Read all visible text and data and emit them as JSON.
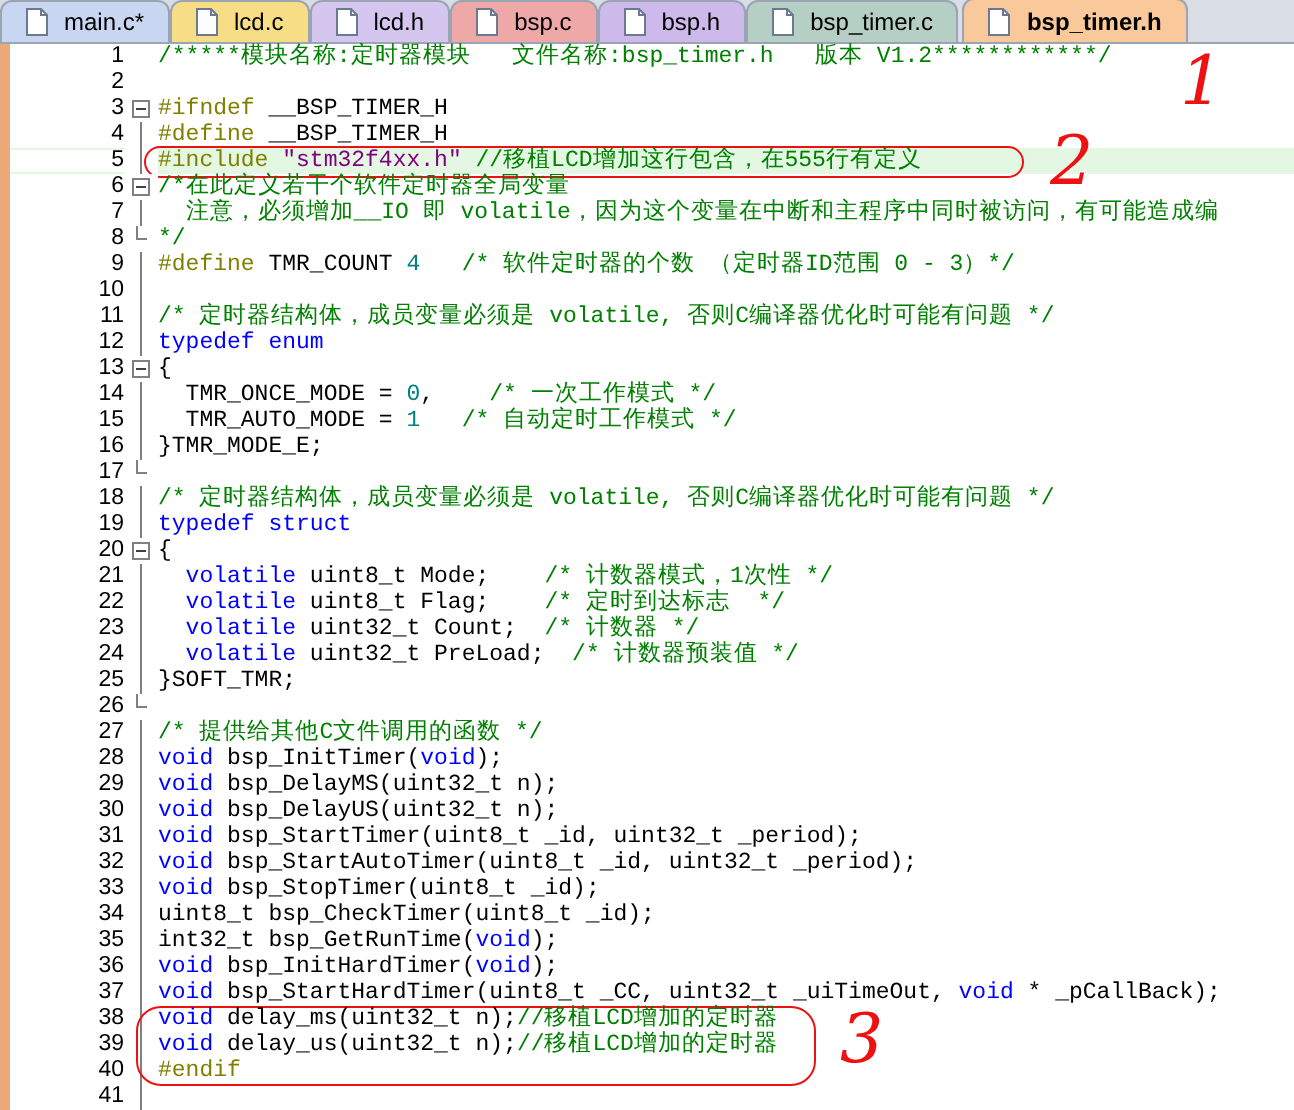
{
  "tabs": [
    {
      "label": "main.c*",
      "selected": false,
      "color": "#c8d6f2"
    },
    {
      "label": "lcd.c",
      "selected": false,
      "color": "#f7dd86"
    },
    {
      "label": "lcd.h",
      "selected": false,
      "color": "#d4c6ee"
    },
    {
      "label": "bsp.c",
      "selected": false,
      "color": "#eea8a8"
    },
    {
      "label": "bsp.h",
      "selected": false,
      "color": "#cdb9ea"
    },
    {
      "label": "bsp_timer.c",
      "selected": false,
      "color": "#b5cfc4"
    },
    {
      "label": "bsp_timer.h",
      "selected": true,
      "color": "#f9c99b"
    }
  ],
  "editor": {
    "lines": [
      {
        "number": "1",
        "kind": "line",
        "highlighted": false,
        "segments": [
          {
            "kind": "comment",
            "text": "/*****模块名称:定时器模块   文件名称:bsp_timer.h   版本 V1.2************/"
          }
        ]
      },
      {
        "number": "2",
        "kind": "line",
        "highlighted": false
      },
      {
        "number": "3",
        "kind": "foldstart",
        "highlighted": false,
        "segments": [
          {
            "kind": "preproc",
            "text": "#ifndef"
          },
          {
            "kind": "plain",
            "text": " __BSP_TIMER_H"
          }
        ]
      },
      {
        "number": "4",
        "kind": "line",
        "highlighted": false,
        "segments": [
          {
            "kind": "preproc",
            "text": "#define"
          },
          {
            "kind": "plain",
            "text": " __BSP_TIMER_H"
          }
        ]
      },
      {
        "number": "5",
        "kind": "line",
        "highlighted": true,
        "segments": [
          {
            "kind": "preproc",
            "text": "#include "
          },
          {
            "kind": "string",
            "text": "\"stm32f4xx.h\""
          },
          {
            "kind": "comment",
            "text": " //移植LCD增加这行包含，在555行有定义"
          }
        ]
      },
      {
        "number": "6",
        "kind": "foldstart",
        "highlighted": false,
        "segments": [
          {
            "kind": "comment",
            "text": "/*在此定义若干个软件定时器全局变量"
          }
        ]
      },
      {
        "number": "7",
        "kind": "line",
        "highlighted": false,
        "segments": [
          {
            "kind": "comment",
            "text": "  注意，必须增加__IO 即 volatile，因为这个变量在中断和主程序中同时被访问，有可能造成编"
          }
        ]
      },
      {
        "number": "8",
        "kind": "foldend",
        "highlighted": false,
        "segments": [
          {
            "kind": "comment",
            "text": "*/"
          }
        ]
      },
      {
        "number": "9",
        "kind": "line",
        "highlighted": false,
        "segments": [
          {
            "kind": "preproc",
            "text": "#define"
          },
          {
            "kind": "plain",
            "text": " TMR_COUNT "
          },
          {
            "kind": "number",
            "text": "4"
          },
          {
            "kind": "comment",
            "text": "   /* 软件定时器的个数 （定时器ID范围 0 - 3）*/"
          }
        ]
      },
      {
        "number": "10",
        "kind": "line",
        "highlighted": false
      },
      {
        "number": "11",
        "kind": "line",
        "highlighted": false,
        "segments": [
          {
            "kind": "comment",
            "text": "/* 定时器结构体，成员变量必须是 volatile, 否则C编译器优化时可能有问题 */"
          }
        ]
      },
      {
        "number": "12",
        "kind": "line",
        "highlighted": false,
        "segments": [
          {
            "kind": "keyword",
            "text": "typedef enum"
          }
        ]
      },
      {
        "number": "13",
        "kind": "foldstart",
        "highlighted": false,
        "segments": [
          {
            "kind": "plain",
            "text": "{"
          }
        ]
      },
      {
        "number": "14",
        "kind": "line",
        "highlighted": false,
        "segments": [
          {
            "kind": "plain",
            "text": "  TMR_ONCE_MODE = "
          },
          {
            "kind": "number",
            "text": "0"
          },
          {
            "kind": "plain",
            "text": ",    "
          },
          {
            "kind": "comment",
            "text": "/* 一次工作模式 */"
          }
        ]
      },
      {
        "number": "15",
        "kind": "line",
        "highlighted": false,
        "segments": [
          {
            "kind": "plain",
            "text": "  TMR_AUTO_MODE = "
          },
          {
            "kind": "number",
            "text": "1"
          },
          {
            "kind": "comment",
            "text": "   /* 自动定时工作模式 */"
          }
        ]
      },
      {
        "number": "16",
        "kind": "line",
        "highlighted": false,
        "segments": [
          {
            "kind": "plain",
            "text": "}TMR_MODE_E;"
          }
        ]
      },
      {
        "number": "17",
        "kind": "foldend",
        "highlighted": false
      },
      {
        "number": "18",
        "kind": "line",
        "highlighted": false,
        "segments": [
          {
            "kind": "comment",
            "text": "/* 定时器结构体，成员变量必须是 volatile, 否则C编译器优化时可能有问题 */"
          }
        ]
      },
      {
        "number": "19",
        "kind": "line",
        "highlighted": false,
        "segments": [
          {
            "kind": "keyword",
            "text": "typedef struct"
          }
        ]
      },
      {
        "number": "20",
        "kind": "foldstart",
        "highlighted": false,
        "segments": [
          {
            "kind": "plain",
            "text": "{"
          }
        ]
      },
      {
        "number": "21",
        "kind": "line",
        "highlighted": false,
        "segments": [
          {
            "kind": "keyword",
            "text": "  volatile"
          },
          {
            "kind": "plain",
            "text": " uint8_t Mode;    "
          },
          {
            "kind": "comment",
            "text": "/* 计数器模式，1次性 */"
          }
        ]
      },
      {
        "number": "22",
        "kind": "line",
        "highlighted": false,
        "segments": [
          {
            "kind": "keyword",
            "text": "  volatile"
          },
          {
            "kind": "plain",
            "text": " uint8_t Flag;    "
          },
          {
            "kind": "comment",
            "text": "/* 定时到达标志  */"
          }
        ]
      },
      {
        "number": "23",
        "kind": "line",
        "highlighted": false,
        "segments": [
          {
            "kind": "keyword",
            "text": "  volatile"
          },
          {
            "kind": "plain",
            "text": " uint32_t Count;  "
          },
          {
            "kind": "comment",
            "text": "/* 计数器 */"
          }
        ]
      },
      {
        "number": "24",
        "kind": "line",
        "highlighted": false,
        "segments": [
          {
            "kind": "keyword",
            "text": "  volatile"
          },
          {
            "kind": "plain",
            "text": " uint32_t PreLoad;  "
          },
          {
            "kind": "comment",
            "text": "/* 计数器预装值 */"
          }
        ]
      },
      {
        "number": "25",
        "kind": "line",
        "highlighted": false,
        "segments": [
          {
            "kind": "plain",
            "text": "}SOFT_TMR;"
          }
        ]
      },
      {
        "number": "26",
        "kind": "foldend",
        "highlighted": false
      },
      {
        "number": "27",
        "kind": "line",
        "highlighted": false,
        "segments": [
          {
            "kind": "comment",
            "text": "/* 提供给其他C文件调用的函数 */"
          }
        ]
      },
      {
        "number": "28",
        "kind": "line",
        "highlighted": false,
        "segments": [
          {
            "kind": "keyword",
            "text": "void"
          },
          {
            "kind": "plain",
            "text": " bsp_InitTimer("
          },
          {
            "kind": "keyword",
            "text": "void"
          },
          {
            "kind": "plain",
            "text": ");"
          }
        ]
      },
      {
        "number": "29",
        "kind": "line",
        "highlighted": false,
        "segments": [
          {
            "kind": "keyword",
            "text": "void"
          },
          {
            "kind": "plain",
            "text": " bsp_DelayMS(uint32_t n);"
          }
        ]
      },
      {
        "number": "30",
        "kind": "line",
        "highlighted": false,
        "segments": [
          {
            "kind": "keyword",
            "text": "void"
          },
          {
            "kind": "plain",
            "text": " bsp_DelayUS(uint32_t n);"
          }
        ]
      },
      {
        "number": "31",
        "kind": "line",
        "highlighted": false,
        "segments": [
          {
            "kind": "keyword",
            "text": "void"
          },
          {
            "kind": "plain",
            "text": " bsp_StartTimer(uint8_t _id, uint32_t _period);"
          }
        ]
      },
      {
        "number": "32",
        "kind": "line",
        "highlighted": false,
        "segments": [
          {
            "kind": "keyword",
            "text": "void"
          },
          {
            "kind": "plain",
            "text": " bsp_StartAutoTimer(uint8_t _id, uint32_t _period);"
          }
        ]
      },
      {
        "number": "33",
        "kind": "line",
        "highlighted": false,
        "segments": [
          {
            "kind": "keyword",
            "text": "void"
          },
          {
            "kind": "plain",
            "text": " bsp_StopTimer(uint8_t _id);"
          }
        ]
      },
      {
        "number": "34",
        "kind": "line",
        "highlighted": false,
        "segments": [
          {
            "kind": "plain",
            "text": "uint8_t bsp_CheckTimer(uint8_t _id);"
          }
        ]
      },
      {
        "number": "35",
        "kind": "line",
        "highlighted": false,
        "segments": [
          {
            "kind": "plain",
            "text": "int32_t bsp_GetRunTime("
          },
          {
            "kind": "keyword",
            "text": "void"
          },
          {
            "kind": "plain",
            "text": ");"
          }
        ]
      },
      {
        "number": "36",
        "kind": "line",
        "highlighted": false,
        "segments": [
          {
            "kind": "keyword",
            "text": "void"
          },
          {
            "kind": "plain",
            "text": " bsp_InitHardTimer("
          },
          {
            "kind": "keyword",
            "text": "void"
          },
          {
            "kind": "plain",
            "text": ");"
          }
        ]
      },
      {
        "number": "37",
        "kind": "line",
        "highlighted": false,
        "segments": [
          {
            "kind": "keyword",
            "text": "void"
          },
          {
            "kind": "plain",
            "text": " bsp_StartHardTimer(uint8_t _CC, uint32_t _uiTimeOut, "
          },
          {
            "kind": "keyword",
            "text": "void"
          },
          {
            "kind": "plain",
            "text": " * _pCallBack);"
          }
        ]
      },
      {
        "number": "38",
        "kind": "line",
        "highlighted": false,
        "segments": [
          {
            "kind": "keyword",
            "text": "void"
          },
          {
            "kind": "plain",
            "text": " delay_ms(uint32_t n);"
          },
          {
            "kind": "comment",
            "text": "//移植LCD增加的定时器"
          }
        ]
      },
      {
        "number": "39",
        "kind": "line",
        "highlighted": false,
        "segments": [
          {
            "kind": "keyword",
            "text": "void"
          },
          {
            "kind": "plain",
            "text": " delay_us(uint32_t n);"
          },
          {
            "kind": "comment",
            "text": "//移植LCD增加的定时器"
          }
        ]
      },
      {
        "number": "40",
        "kind": "line",
        "highlighted": false,
        "segments": [
          {
            "kind": "preproc",
            "text": "#endif"
          }
        ]
      },
      {
        "number": "41",
        "kind": "line",
        "highlighted": false
      }
    ]
  },
  "annotations": [
    {
      "label": "1"
    },
    {
      "label": "2"
    },
    {
      "label": "3"
    }
  ]
}
